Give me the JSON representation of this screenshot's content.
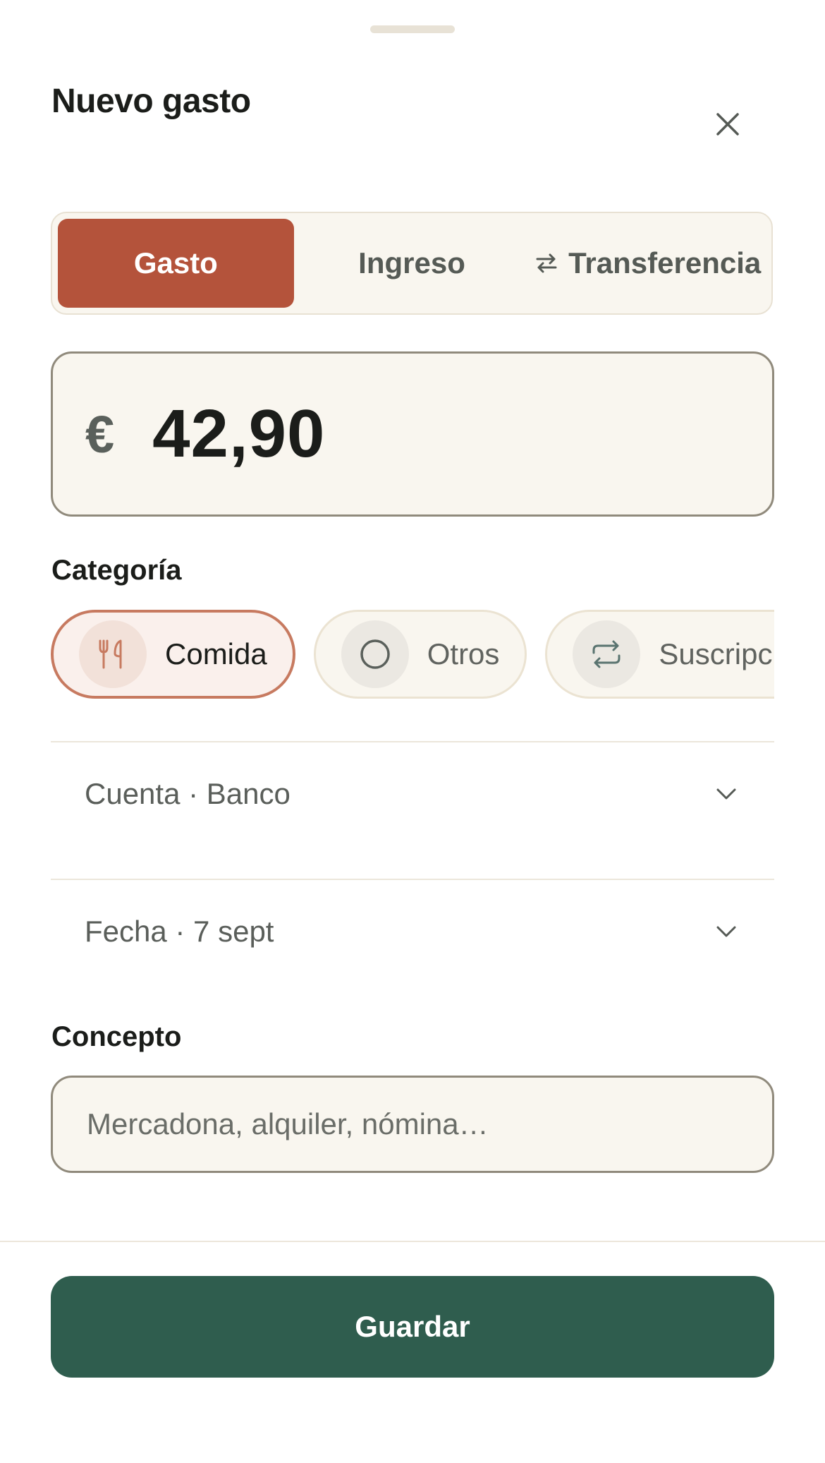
{
  "sheet": {
    "title": "Nuevo gasto",
    "close_icon": "close-icon"
  },
  "type_tabs": [
    {
      "label": "Gasto",
      "active": true
    },
    {
      "label": "Ingreso",
      "active": false
    },
    {
      "label": "Transferencia",
      "active": false,
      "icon": "swap-arrows-icon"
    }
  ],
  "amount": {
    "currency": "€",
    "value": "42,90"
  },
  "category": {
    "label": "Categoría",
    "chips": [
      {
        "label": "Comida",
        "icon": "fork-knife-icon",
        "selected": true
      },
      {
        "label": "Otros",
        "icon": "circle-icon",
        "selected": false
      },
      {
        "label": "Suscripciones",
        "icon": "repeat-icon",
        "selected": false
      }
    ]
  },
  "account": {
    "text": "Cuenta · Banco",
    "icon": "chevron-down-icon"
  },
  "date": {
    "text": "Fecha · 7 sept",
    "icon": "chevron-down-icon"
  },
  "concept": {
    "label": "Concepto",
    "value": "",
    "placeholder": "Mercadona, alquiler, nómina…"
  },
  "save_label": "Guardar",
  "colors": {
    "accent": "#b4533b",
    "primary": "#2f5d4e",
    "surface": "#f9f6ef"
  }
}
